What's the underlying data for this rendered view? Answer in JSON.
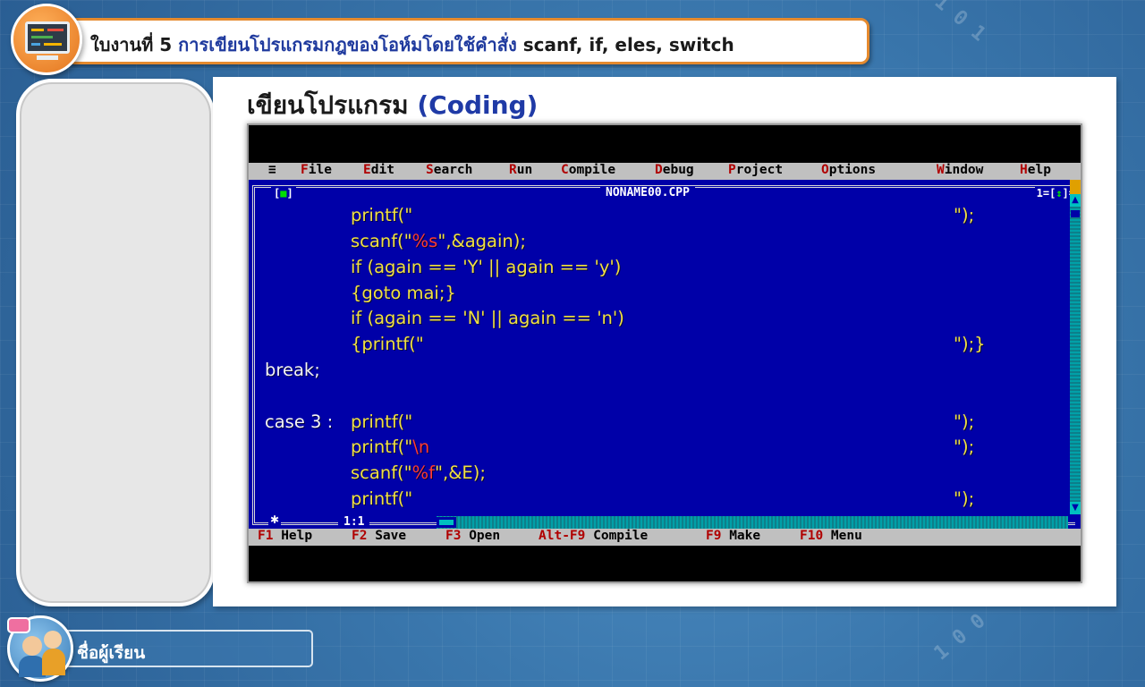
{
  "worksheet": {
    "prefix": "ใบงานที่ 5 ",
    "title_accent": "การเขียนโปรแกรมกฎของโอห์มโดยใช้คำสั่ง ",
    "title_tail": "scanf, if, eles, switch"
  },
  "section": {
    "heading": "เขียนโปรแกรม ",
    "heading_accent": "(Coding)"
  },
  "ide": {
    "menu": {
      "system": "≡",
      "items": [
        {
          "hot": "F",
          "rest": "ile"
        },
        {
          "hot": "E",
          "rest": "dit"
        },
        {
          "hot": "S",
          "rest": "earch"
        },
        {
          "hot": "R",
          "rest": "un"
        },
        {
          "hot": "C",
          "rest": "ompile"
        },
        {
          "hot": "D",
          "rest": "ebug"
        },
        {
          "hot": "P",
          "rest": "roject"
        },
        {
          "hot": "O",
          "rest": "ptions"
        },
        {
          "hot": "W",
          "rest": "indow"
        },
        {
          "hot": "H",
          "rest": "elp"
        }
      ]
    },
    "window": {
      "close_box": "[■]",
      "file_name": "NONAME00.CPP",
      "window_number": "1=[↕]=",
      "cursor_pos": "1:1"
    },
    "code": [
      {
        "a": "printf(\"",
        "b": "",
        "end": "\");"
      },
      {
        "a": "scanf(\"",
        "b": "%s",
        "c": "\",&again);",
        "end": ""
      },
      {
        "a": "if (again == 'Y' || again == 'y')",
        "b": "",
        "end": ""
      },
      {
        "a": "{goto mai;}",
        "b": "",
        "end": ""
      },
      {
        "a": "if (again == 'N' || again == 'n')",
        "b": "",
        "end": ""
      },
      {
        "a": "{printf(\"",
        "b": "",
        "end": "\");}"
      },
      {
        "a": "break;",
        "b": "",
        "end": ""
      },
      {
        "a": "",
        "b": "",
        "end": ""
      },
      {
        "a": "case 3 :",
        "b": "printf(\"",
        "end": "\");"
      },
      {
        "a": "printf(\"",
        "b": "\\n",
        "end": "\");"
      },
      {
        "a": "scanf(\"",
        "b": "%f",
        "c": "\",&E);",
        "end": ""
      },
      {
        "a": "printf(\"",
        "b": "",
        "end": "\");"
      }
    ],
    "status": [
      {
        "key": "F1",
        "label": " Help"
      },
      {
        "key": "F2",
        "label": " Save"
      },
      {
        "key": "F3",
        "label": " Open"
      },
      {
        "key": "Alt-F9",
        "label": " Compile"
      },
      {
        "key": "F9",
        "label": " Make"
      },
      {
        "key": "F10",
        "label": " Menu"
      }
    ]
  },
  "student": {
    "name_label": "ชื่อผู้เรียน"
  },
  "colors": {
    "editor_bg": "#0000a8",
    "code_text": "#f0e040",
    "string_red": "#ff3b2f",
    "header_border": "#e58a2e",
    "heading_accent": "#1f3aa6"
  }
}
